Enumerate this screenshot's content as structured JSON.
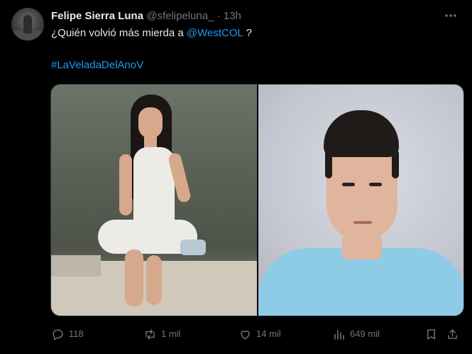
{
  "tweet": {
    "author_name": "Felipe Sierra Luna",
    "handle": "@sfelipeluna_",
    "separator": "·",
    "time": "13h",
    "text_before": "¿Quién volvió más mierda a ",
    "mention": "@WestCOL",
    "text_after": " ?",
    "hashtag": "#LaVeladaDelAnoV"
  },
  "actions": {
    "replies": "118",
    "retweets": "1 mil",
    "likes": "14 mil",
    "views": "649 mil"
  },
  "icons": {
    "more": "more-icon",
    "reply": "reply-icon",
    "retweet": "retweet-icon",
    "like": "heart-icon",
    "views": "views-icon",
    "bookmark": "bookmark-icon",
    "share": "share-icon"
  },
  "colors": {
    "background": "#000000",
    "text": "#e7e9ea",
    "muted": "#71767b",
    "link": "#1d9bf0"
  }
}
